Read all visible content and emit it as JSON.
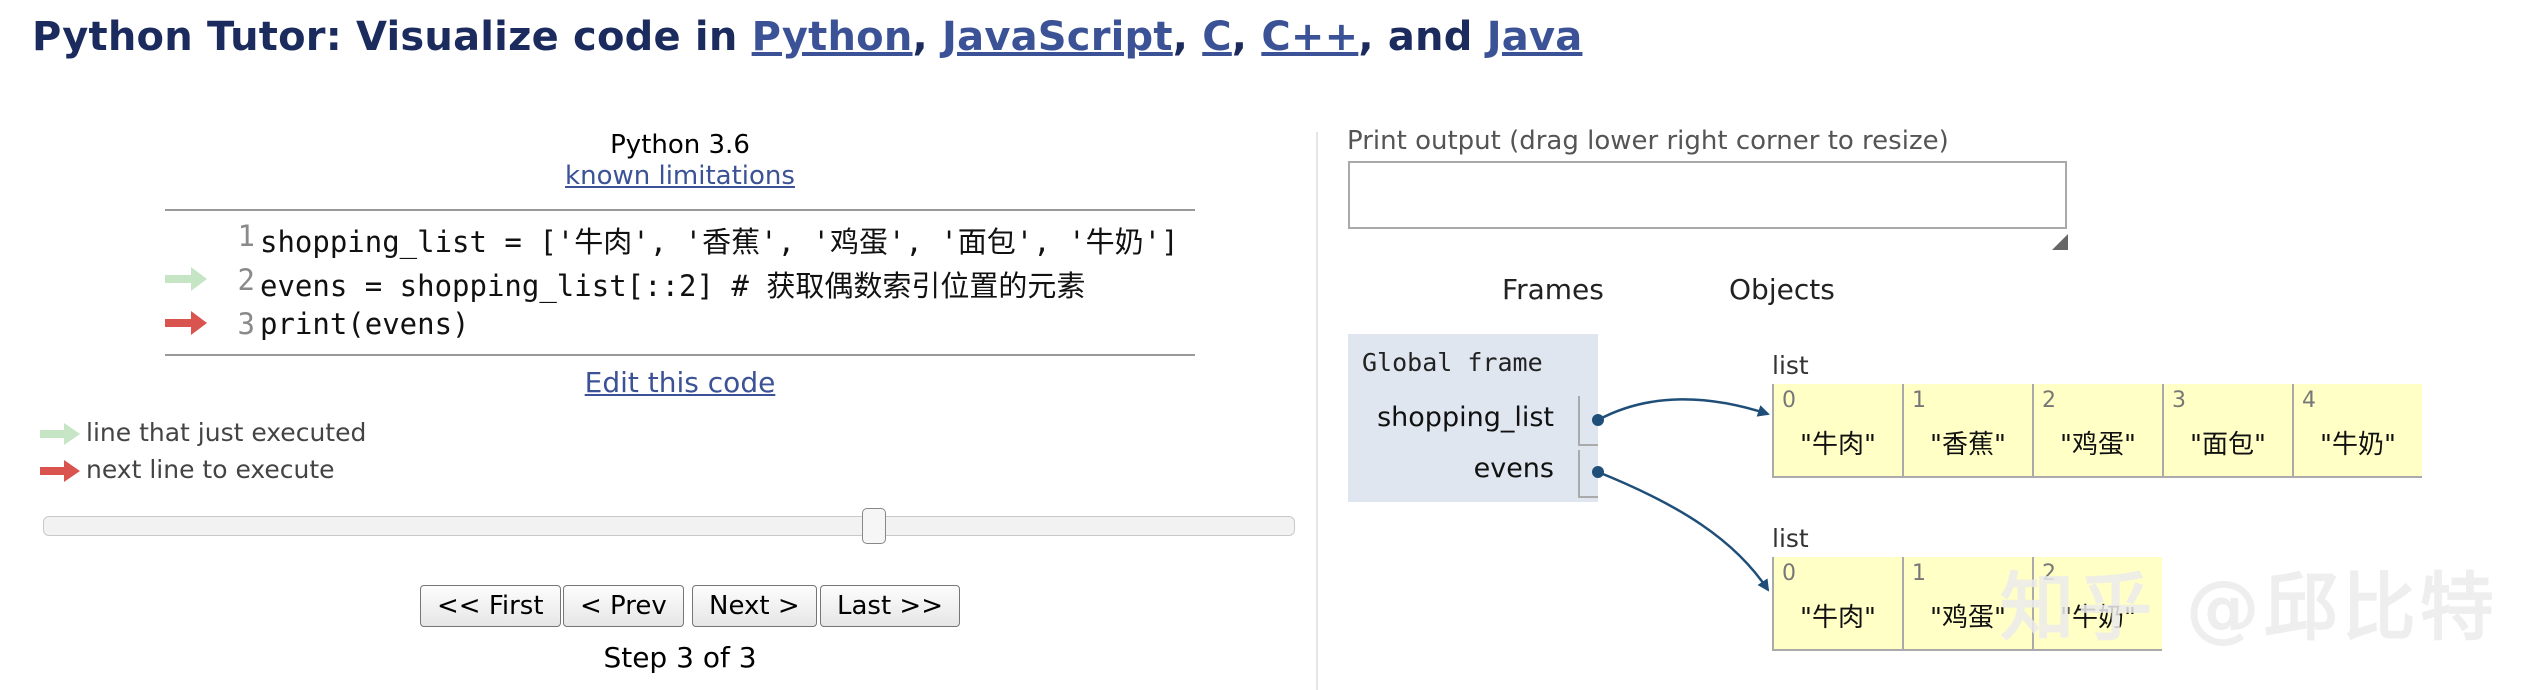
{
  "header": {
    "prefix": "Python Tutor: Visualize code in ",
    "links": [
      "Python",
      "JavaScript",
      "C",
      "C++",
      "Java"
    ],
    "sep1": ", ",
    "sep2": ", ",
    "sep3": ", ",
    "sep4": ", and "
  },
  "editor": {
    "language": "Python 3.6",
    "limitations_link": "known limitations",
    "lines": [
      {
        "num": "1",
        "code": "shopping_list = ['牛肉', '香蕉', '鸡蛋', '面包', '牛奶']"
      },
      {
        "num": "2",
        "code": "evens = shopping_list[::2] # 获取偶数索引位置的元素"
      },
      {
        "num": "3",
        "code": "print(evens)"
      }
    ],
    "edit_link": "Edit this code"
  },
  "legend": {
    "just_executed": "line that just executed",
    "next_line": "next line to execute"
  },
  "controls": {
    "first": "<< First",
    "prev": "< Prev",
    "next": "Next >",
    "last": "Last >>",
    "step": "Step 3 of 3",
    "current_step": 3,
    "total_steps": 3
  },
  "output": {
    "label": "Print output (drag lower right corner to resize)",
    "text": ""
  },
  "viz": {
    "frames_heading": "Frames",
    "objects_heading": "Objects",
    "global_frame": "Global frame",
    "variables": [
      "shopping_list",
      "evens"
    ],
    "list1": {
      "label": "list",
      "indices": [
        "0",
        "1",
        "2",
        "3",
        "4"
      ],
      "values": [
        "\"牛肉\"",
        "\"香蕉\"",
        "\"鸡蛋\"",
        "\"面包\"",
        "\"牛奶\""
      ]
    },
    "list2": {
      "label": "list",
      "indices": [
        "0",
        "1",
        "2"
      ],
      "values": [
        "\"牛肉\"",
        "\"鸡蛋\"",
        "\"牛奶\""
      ]
    }
  },
  "watermark": "知乎 @邱比特",
  "colors": {
    "title": "#1b2b5d",
    "link": "#3b5296",
    "arrow_executed": "#c5e5c5",
    "arrow_next": "#d9534f",
    "frame_bg": "#dfe6f0",
    "heap_bg": "#ffffc6",
    "pointer": "#1f4e79"
  }
}
